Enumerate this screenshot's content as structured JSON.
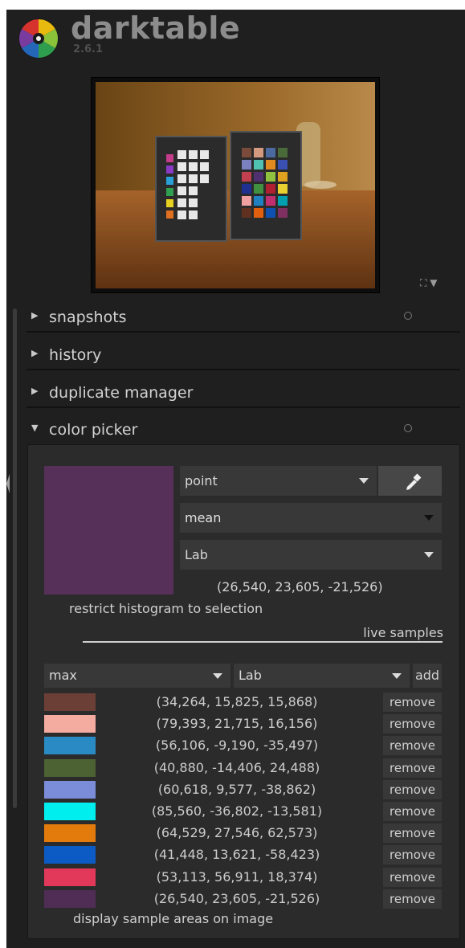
{
  "app": {
    "name": "darktable",
    "version": "2.6.1"
  },
  "modules": [
    {
      "label": "snapshots"
    },
    {
      "label": "history"
    },
    {
      "label": "duplicate manager"
    },
    {
      "label": "color picker"
    }
  ],
  "color_picker": {
    "mode": "point",
    "statistic": "mean",
    "color_space": "Lab",
    "value": "(26,540, 23,605, -21,526)",
    "swatch_color": "#563058",
    "restrict_histogram_label": "restrict histogram to selection",
    "live_samples_label": "live samples",
    "sample_statistic": "max",
    "sample_color_space": "Lab",
    "add_label": "add",
    "remove_label": "remove",
    "display_samples_label": "display sample areas on image",
    "samples": [
      {
        "value": "(34,264, 15,825, 15,868)",
        "color": "#6b3f35"
      },
      {
        "value": "(79,393, 21,715, 16,156)",
        "color": "#f4aba0"
      },
      {
        "value": "(56,106, -9,190, -35,497)",
        "color": "#2a8ac4"
      },
      {
        "value": "(40,880, -14,406, 24,488)",
        "color": "#4c6232"
      },
      {
        "value": "(60,618, 9,577, -38,862)",
        "color": "#7b8dd8"
      },
      {
        "value": "(85,560, -36,802, -13,581)",
        "color": "#00efee"
      },
      {
        "value": "(64,529, 27,546, 62,573)",
        "color": "#e37b0c"
      },
      {
        "value": "(41,448, 13,621, -58,423)",
        "color": "#0c5bc4"
      },
      {
        "value": "(53,113, 56,911, 18,374)",
        "color": "#e2385a"
      },
      {
        "value": "(26,540, 23,605, -21,526)",
        "color": "#4f2d55"
      }
    ]
  }
}
